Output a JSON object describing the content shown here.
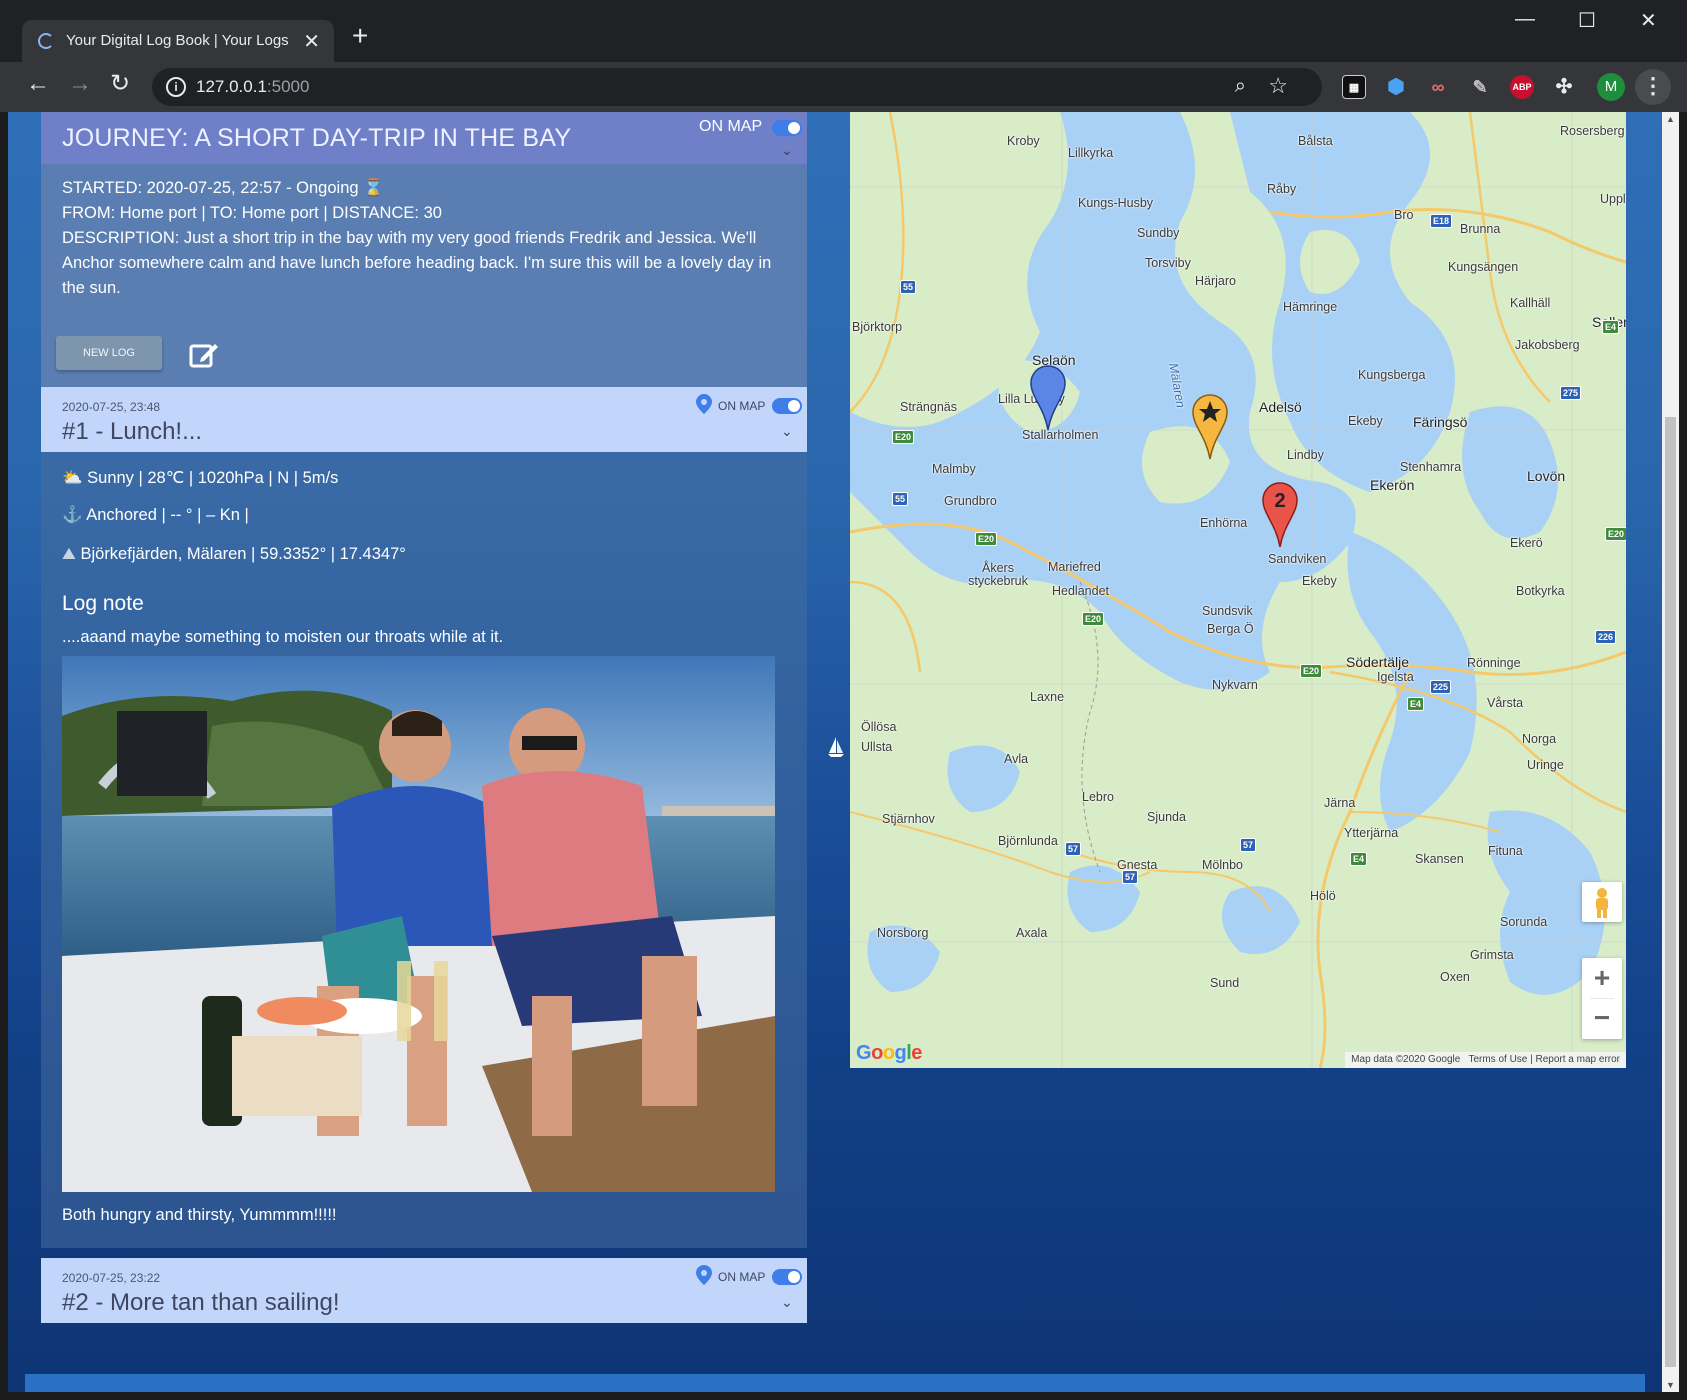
{
  "browser": {
    "tab_title": "Your Digital Log Book | Your Logs",
    "url_host": "127.0.0.1",
    "url_port": ":5000",
    "new_tab": "+",
    "close_tab": "✕",
    "window": {
      "minimize": "—",
      "maximize": "☐",
      "close": "✕"
    },
    "extensions": [
      "ABP"
    ],
    "profile_initial": "M"
  },
  "journey": {
    "title": "JOURNEY: A SHORT DAY-TRIP IN THE BAY",
    "on_map_label": "ON MAP",
    "on_map_enabled": true,
    "started": "STARTED: 2020-07-25, 22:57 - Ongoing",
    "route": "FROM: Home port | TO: Home port | DISTANCE: 30",
    "description": "DESCRIPTION: Just a short trip in the bay with my very good friends Fredrik and Jessica. We'll Anchor somewhere calm and have lunch before heading back. I'm sure this will be a lovely day in the sun.",
    "new_log_button": "NEW LOG"
  },
  "logs": [
    {
      "timestamp": "2020-07-25, 23:48",
      "title": "#1 - Lunch!...",
      "on_map_label": "ON MAP",
      "on_map_enabled": true,
      "weather_line": "Sunny | 28℃ | 1020hPa | N | 5m/s",
      "weather": {
        "sky": "Sunny",
        "temp": "28℃",
        "pressure": "1020hPa",
        "wind_dir": "N",
        "wind_speed": "5m/s"
      },
      "status_line": "Anchored | -- ° | – Kn |",
      "position_line": "Björkefjärden, Mälaren | 59.3352° | 17.4347°",
      "note_heading": "Log note",
      "note_text": "....aaand maybe something to moisten our throats while at it.",
      "photo_caption": "Both hungry and thirsty, Yummmm!!!!!"
    },
    {
      "timestamp": "2020-07-25, 23:22",
      "title": "#2 - More tan than sailing!",
      "on_map_label": "ON MAP",
      "on_map_enabled": true
    }
  ],
  "map": {
    "labels": [
      "Kroby",
      "Lillkyrka",
      "Bålsta",
      "Rosersberg",
      "Kungs-Husby",
      "Råby",
      "Bro",
      "Brunna",
      "Upplands Väsby",
      "Sundby",
      "Torsviby",
      "Härjaro",
      "Kungsängen",
      "Hämringe",
      "Kallhäll",
      "Björktorp",
      "Sollentuna",
      "Jakobsberg",
      "Selaön",
      "Lilla Lundby",
      "Stallarholmen",
      "Strängnäs",
      "Adelsö",
      "Kungsberga",
      "Ekeby",
      "Färingsö",
      "Lindby",
      "Stenhamra",
      "Lovön",
      "Ekerön",
      "Malmby",
      "Grundbro",
      "Enhörna",
      "Sandviken",
      "Ekerö",
      "Åkers styckebruk",
      "Mariefred",
      "Hedlandet",
      "Ekeby",
      "Botkyrka",
      "Sundsvik",
      "Berga Ö",
      "Södertälje",
      "Igelsta",
      "Rönninge",
      "Nykvarn",
      "Laxne",
      "Vårsta",
      "Öllösa",
      "Ullsta",
      "Avla",
      "Norga",
      "Uringe",
      "Lebro",
      "Järna",
      "Stjärnhov",
      "Sjunda",
      "Ytterjärna",
      "Fituna",
      "Björnlunda",
      "Gnesta",
      "Mölnbo",
      "Skansen",
      "Hölö",
      "Norsborg",
      "Axala",
      "Sorunda",
      "Grimsta",
      "Sund",
      "Oxen",
      "Mälaren"
    ],
    "roads": [
      "E18",
      "55",
      "E20",
      "E4",
      "275",
      "57",
      "226",
      "225"
    ],
    "attribution": "Map data ©2020 Google",
    "terms": "Terms of Use",
    "report": "Report a map error",
    "zoom_in": "+",
    "zoom_out": "−",
    "logo": "Google",
    "markers": [
      {
        "type": "start",
        "color": "#5b86e5"
      },
      {
        "type": "star",
        "color": "#f6b740"
      },
      {
        "type": "numbered",
        "label": "2",
        "color": "#e9544a"
      }
    ]
  }
}
